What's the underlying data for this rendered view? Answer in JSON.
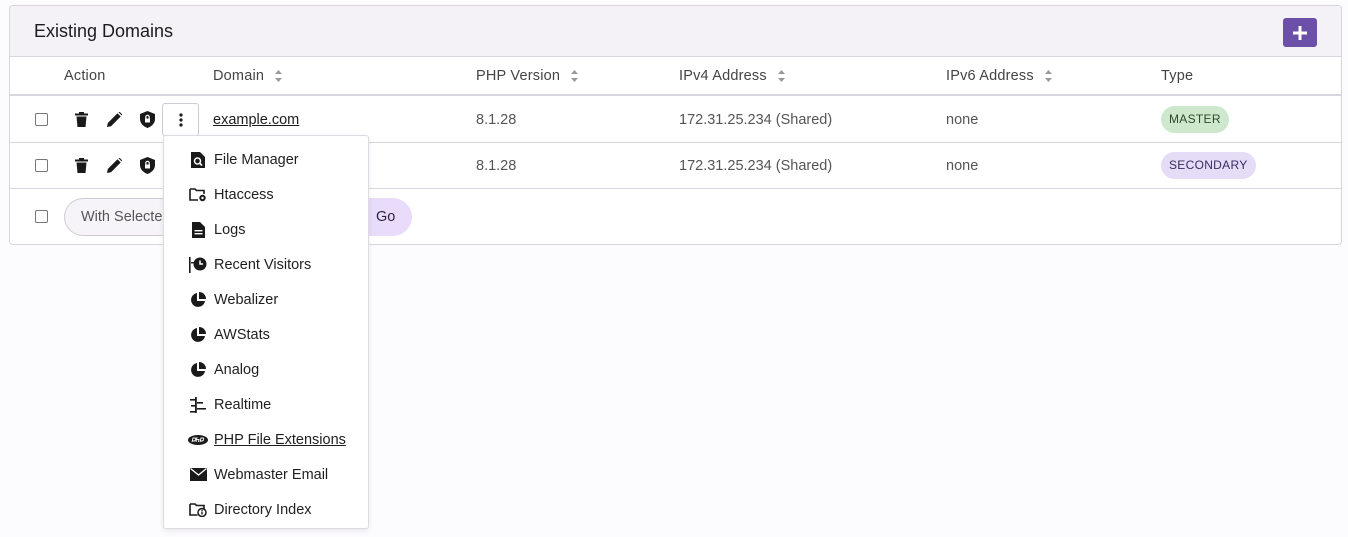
{
  "panel": {
    "title": "Existing Domains",
    "accent_color": "#6b4fa8"
  },
  "table": {
    "headers": {
      "action": "Action",
      "domain": "Domain",
      "php": "PHP Version",
      "ipv4": "IPv4 Address",
      "ipv6": "IPv6 Address",
      "type": "Type"
    },
    "rows": [
      {
        "domain": "example.com",
        "php": "8.1.28",
        "ipv4": "172.31.25.234 (Shared)",
        "ipv6": "none",
        "type": "MASTER"
      },
      {
        "domain": "",
        "php": "8.1.28",
        "ipv4": "172.31.25.234 (Shared)",
        "ipv6": "none",
        "type": "SECONDARY"
      }
    ]
  },
  "bulk": {
    "select_text": "With Selecte",
    "go_label": "Go"
  },
  "dropdown": {
    "items": [
      {
        "label": "File Manager",
        "icon": "file-search-icon"
      },
      {
        "label": "Htaccess",
        "icon": "folder-gear-icon"
      },
      {
        "label": "Logs",
        "icon": "document-icon"
      },
      {
        "label": "Recent Visitors",
        "icon": "clock-timeline-icon"
      },
      {
        "label": "Webalizer",
        "icon": "pie-chart-icon"
      },
      {
        "label": "AWStats",
        "icon": "pie-chart-icon"
      },
      {
        "label": "Analog",
        "icon": "pie-chart-icon"
      },
      {
        "label": "Realtime",
        "icon": "realtime-icon"
      },
      {
        "label": "PHP File Extensions",
        "icon": "php-icon"
      },
      {
        "label": "Webmaster Email",
        "icon": "envelope-icon"
      },
      {
        "label": "Directory Index",
        "icon": "folder-info-icon"
      }
    ]
  }
}
